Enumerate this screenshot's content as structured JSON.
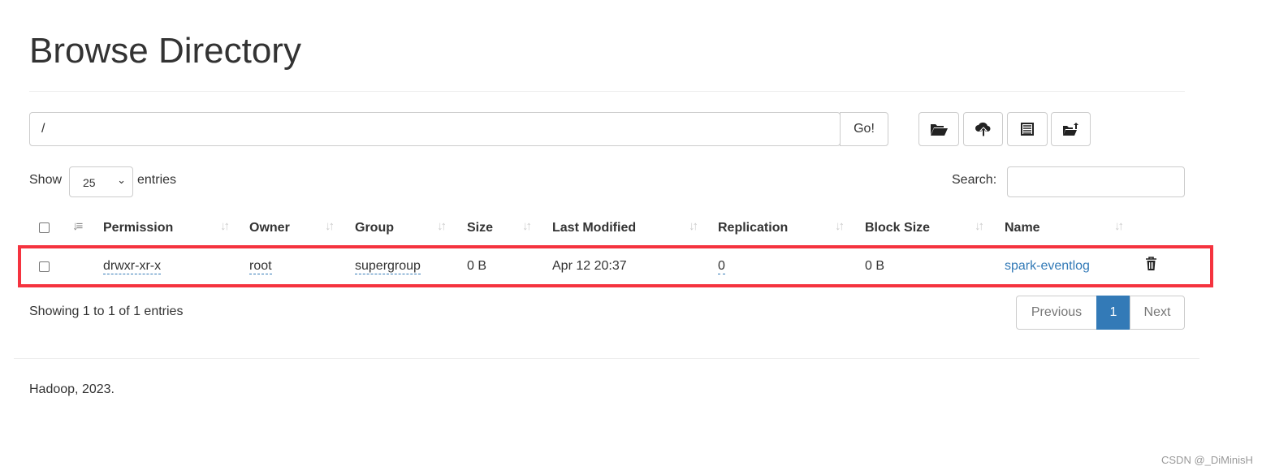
{
  "title": "Browse Directory",
  "path_input": {
    "value": "/",
    "go_label": "Go!"
  },
  "toolbar": [
    {
      "icon": "folder-open-icon"
    },
    {
      "icon": "cloud-upload-icon"
    },
    {
      "icon": "list-icon"
    },
    {
      "icon": "folder-upload-icon"
    }
  ],
  "length": {
    "show": "Show",
    "value": "25",
    "entries": "entries"
  },
  "search": {
    "label": "Search:",
    "value": ""
  },
  "columns": [
    "Permission",
    "Owner",
    "Group",
    "Size",
    "Last Modified",
    "Replication",
    "Block Size",
    "Name"
  ],
  "rows": [
    {
      "permission": "drwxr-xr-x",
      "owner": "root",
      "group": "supergroup",
      "size": "0 B",
      "last_modified": "Apr 12 20:37",
      "replication": "0",
      "block_size": "0 B",
      "name": "spark-eventlog"
    }
  ],
  "info": "Showing 1 to 1 of 1 entries",
  "pagination": {
    "previous": "Previous",
    "current": "1",
    "next": "Next"
  },
  "footer": "Hadoop, 2023.",
  "watermark": "CSDN @_DiMinisH",
  "colors": {
    "link": "#337ab7",
    "highlight": "#f5333f",
    "active_page": "#337ab7"
  }
}
